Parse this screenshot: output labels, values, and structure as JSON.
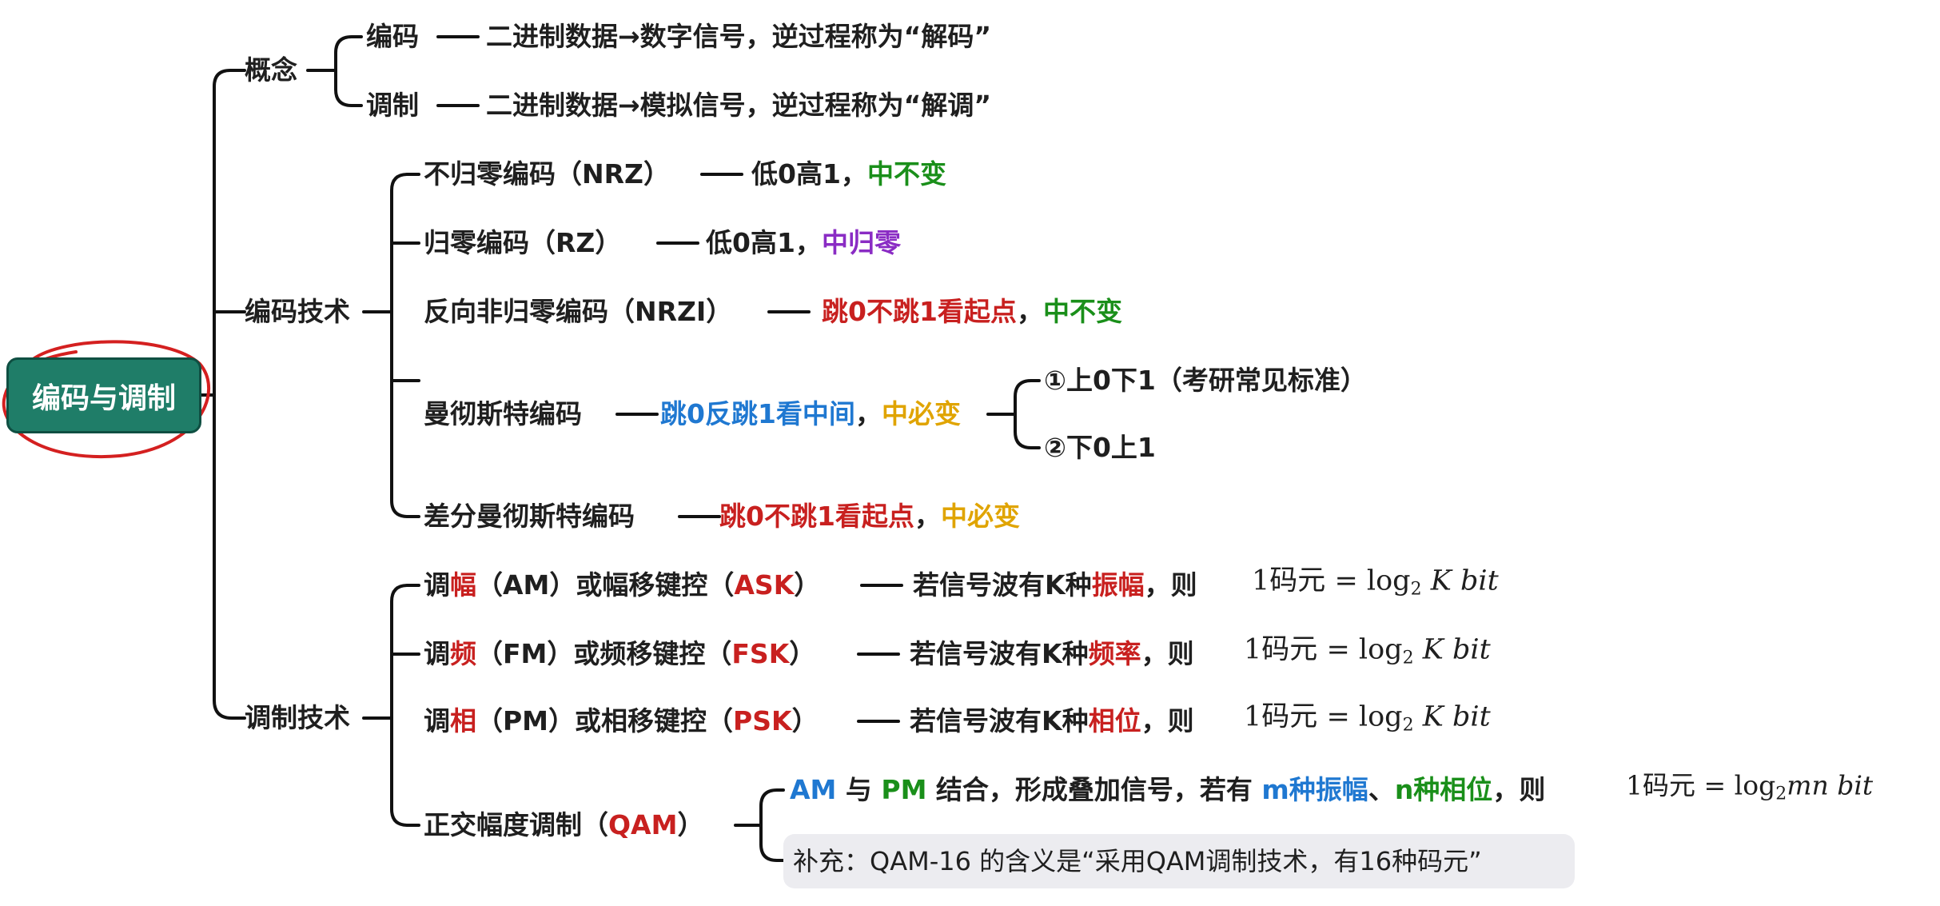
{
  "root": {
    "label": "编码与调制"
  },
  "concept": {
    "label": "概念",
    "encode": {
      "label": "编码",
      "desc": "二进制数据→数字信号，逆过程称为“解码”"
    },
    "modulate": {
      "label": "调制",
      "desc": "二进制数据→模拟信号，逆过程称为“解调”"
    }
  },
  "coding": {
    "label": "编码技术",
    "nrz": {
      "label": "不归零编码（NRZ）",
      "desc": "低0高1，",
      "hl": "中不变"
    },
    "rz": {
      "label": "归零编码（RZ）",
      "desc": "低0高1，",
      "hl": "中归零"
    },
    "nrzi": {
      "label": "反向非归零编码（NRZI）",
      "hl1": "跳0不跳1看起点",
      "sep": "，",
      "hl2": "中不变"
    },
    "manchester": {
      "label": "曼彻斯特编码",
      "hl1": "跳0反跳1看中间",
      "sep": "，",
      "hl2": "中必变",
      "opt1": "①上0下1（考研常见标准）",
      "opt2": "②下0上1"
    },
    "diff": {
      "label": "差分曼彻斯特编码",
      "hl1": "跳0不跳1看起点",
      "sep": "，",
      "hl2": "中必变"
    }
  },
  "modulation": {
    "label": "调制技术",
    "formula": {
      "unit": "码元",
      "eq": "=",
      "log": "log",
      "base": "2",
      "k": "K",
      "bit": "bit",
      "mn": "mn",
      "one": "1"
    },
    "am": {
      "pre": "调",
      "hl": "幅",
      "mid": "（AM）或幅移键控（",
      "abbr": "ASK",
      "post": "）",
      "cond": "若信号波有K种",
      "prop": "振幅",
      "then": "，则"
    },
    "fm": {
      "pre": "调",
      "hl": "频",
      "mid": "（FM）或频移键控（",
      "abbr": "FSK",
      "post": "）",
      "cond": "若信号波有K种",
      "prop": "频率",
      "then": "，则"
    },
    "pm": {
      "pre": "调",
      "hl": "相",
      "mid": "（PM）或相移键控（",
      "abbr": "PSK",
      "post": "）",
      "cond": "若信号波有K种",
      "prop": "相位",
      "then": "，则"
    },
    "qam": {
      "label": "正交幅度调制（",
      "abbr": "QAM",
      "post": "）",
      "am": "AM",
      "with": "与",
      "pm": "PM",
      "desc": "结合，形成叠加信号，若有",
      "m": "m种振幅",
      "dot": "、",
      "n": "n种相位",
      "then": "，则",
      "note": "补充：QAM-16 的含义是“采用QAM调制技术，有16种码元”"
    }
  },
  "annotation": {
    "color": "#d42020"
  }
}
